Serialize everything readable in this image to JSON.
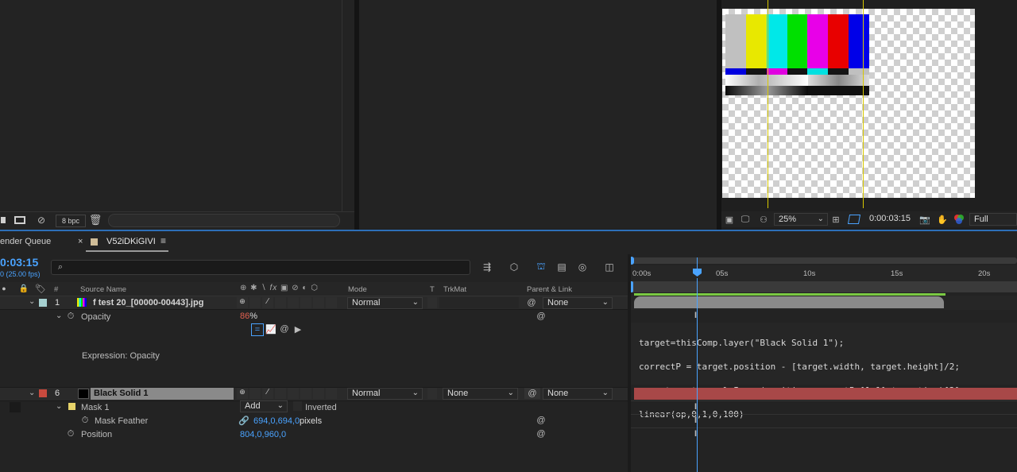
{
  "project_panel": {
    "bpc_label": "8 bpc"
  },
  "viewer": {
    "zoom": "25%",
    "timecode": "0:00:03:15",
    "resolution": "Full",
    "test_bar_colors": [
      "#c0c0c0",
      "#e8e800",
      "#00e8e8",
      "#00e000",
      "#e800e8",
      "#e80000",
      "#0000e8"
    ],
    "guide_color": "#d8c800"
  },
  "tabs": {
    "render_queue": "ender Queue",
    "comp_name": "V52iDKiGIVI"
  },
  "timeline": {
    "current_time": "0:03:15",
    "fps": "0 (25.00 fps)",
    "search_placeholder": "",
    "columns": {
      "num": "#",
      "source_name": "Source Name",
      "mode": "Mode",
      "t": "T",
      "trkmat": "TrkMat",
      "parent": "Parent & Link"
    },
    "ruler": {
      "t0": "0:00s",
      "t5": "05s",
      "t10": "10s",
      "t15": "15s",
      "t20": "20s"
    },
    "layer1": {
      "num": "1",
      "name": "f test 20_[00000-00443].jpg",
      "mode": "Normal",
      "parent": "None",
      "label_color": "#a6d0d0"
    },
    "opacity": {
      "label": "Opacity",
      "value": "86",
      "unit": "%"
    },
    "expression_label": "Expression: Opacity",
    "expression_lines": [
      "target=thisComp.layer(\"Black Solid 1\");",
      "correctP = target.position - [target.width, target.height]/2;",
      "op = target.sampleImage(position-correctP,[1,1],true,time)[3];",
      "linear(op,0,1,0,100)"
    ],
    "layer6": {
      "num": "6",
      "name": "Black Solid 1",
      "mode": "Normal",
      "trkmat": "None",
      "parent": "None",
      "label_color": "#c84a3e",
      "bar_color": "#a84848"
    },
    "mask": {
      "label": "Mask 1",
      "mode": "Add",
      "inverted": "Inverted",
      "label_color": "#e6d36a"
    },
    "mask_feather": {
      "label": "Mask Feather",
      "value": "694,0,694,0",
      "unit": "pixels"
    },
    "position": {
      "label": "Position",
      "value": "804,0,960,0"
    }
  },
  "colors": {
    "accent_blue": "#4aa3ff",
    "layer1_bar": "#8a8a8a",
    "work_area": "#7ac943"
  }
}
